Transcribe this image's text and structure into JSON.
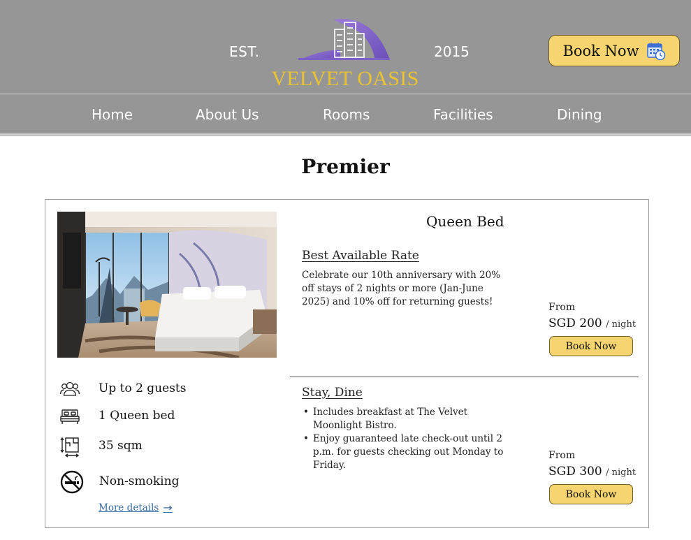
{
  "header": {
    "est_label": "EST.",
    "year": "2015",
    "brand_name": "VELVET OASIS",
    "book_now_label": "Book Now",
    "brand_color": "#e9c430",
    "header_bg": "#969696",
    "button_color": "#f6d46f",
    "logo_icon": "city-arch-logo",
    "book_icon": "calendar-clock-icon"
  },
  "nav": {
    "items": [
      {
        "label": "Home"
      },
      {
        "label": "About Us"
      },
      {
        "label": "Rooms"
      },
      {
        "label": "Facilities"
      },
      {
        "label": "Dining"
      }
    ]
  },
  "page": {
    "title": "Premier"
  },
  "room": {
    "name": "Queen Bed",
    "features": [
      {
        "icon": "guests-icon",
        "text": "Up to 2 guests"
      },
      {
        "icon": "bed-icon",
        "text": "1 Queen bed"
      },
      {
        "icon": "floor-plan-icon",
        "text": "35 sqm"
      },
      {
        "icon": "no-smoking-icon",
        "text": "Non-smoking"
      }
    ],
    "more_details_label": "More details",
    "rates": [
      {
        "title": "Best Available Rate",
        "description": "Celebrate our 10th anniversary with 20% off stays of 2 nights or more (Jan-June 2025) and 10% off for returning guests!",
        "from_label": "From",
        "price": "SGD 200",
        "per_night": "/ night",
        "button_label": "Book Now"
      },
      {
        "title": "Stay, Dine",
        "bullets": [
          "Includes breakfast at The Velvet Moonlight Bistro.",
          "Enjoy guaranteed late check-out until 2 p.m. for guests checking out Monday to Friday."
        ],
        "from_label": "From",
        "price": "SGD 300",
        "per_night": "/ night",
        "button_label": "Book Now"
      }
    ]
  }
}
